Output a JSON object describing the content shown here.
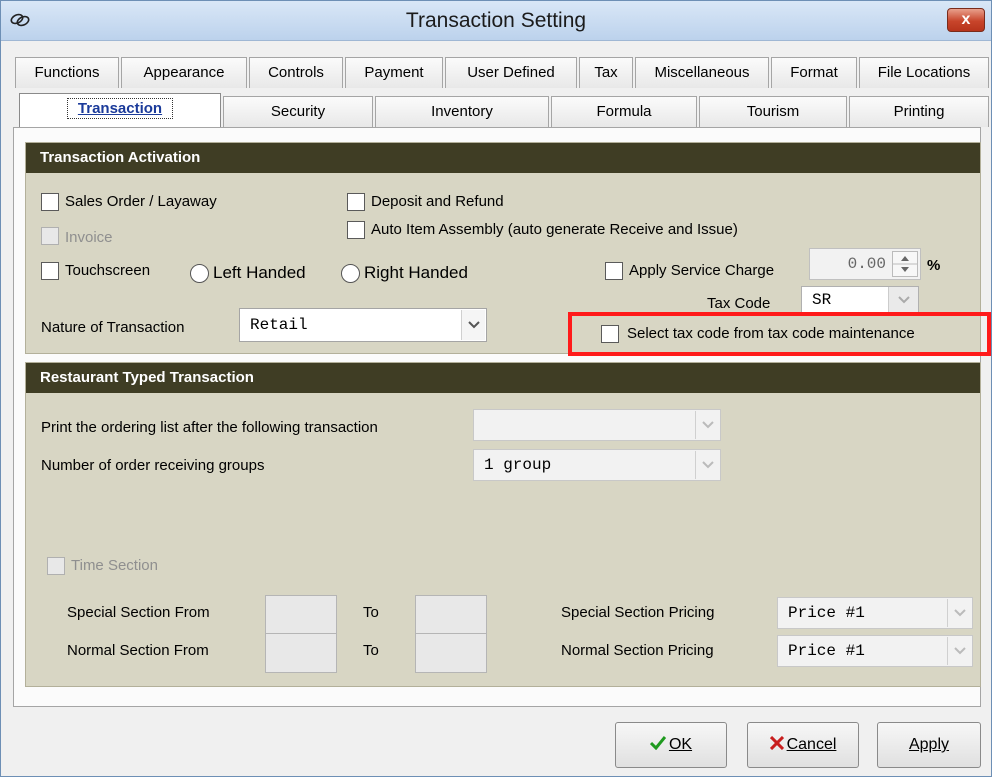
{
  "window": {
    "title": "Transaction Setting",
    "close_label": "x"
  },
  "tabs_row1": [
    "Functions",
    "Appearance",
    "Controls",
    "Payment",
    "User Defined",
    "Tax",
    "Miscellaneous",
    "Format",
    "File Locations"
  ],
  "tabs_row2": [
    "Transaction",
    "Security",
    "Inventory",
    "Formula",
    "Tourism",
    "Printing"
  ],
  "activation": {
    "header": "Transaction Activation",
    "sales_order": "Sales Order / Layaway",
    "invoice": "Invoice",
    "deposit_refund": "Deposit and Refund",
    "auto_assembly": "Auto Item Assembly (auto generate Receive and Issue)",
    "touchscreen": "Touchscreen",
    "left_handed": "Left Handed",
    "right_handed": "Right Handed",
    "apply_service_charge": "Apply Service Charge",
    "service_charge_value": "0.00",
    "percent": "%",
    "tax_code_label": "Tax Code",
    "tax_code_value": "SR",
    "nature_label": "Nature of Transaction",
    "nature_value": "Retail",
    "select_tax_code": "Select tax code from tax code maintenance"
  },
  "restaurant": {
    "header": "Restaurant Typed Transaction",
    "print_ordering_label": "Print the ordering list after the following transaction",
    "print_ordering_value": "",
    "order_groups_label": "Number of order receiving groups",
    "order_groups_value": "1 group",
    "time_section": "Time Section",
    "special_from": "Special Section From",
    "normal_from": "Normal Section From",
    "to": "To",
    "special_pricing": "Special Section Pricing",
    "normal_pricing": "Normal Section Pricing",
    "special_pricing_value": "Price #1",
    "normal_pricing_value": "Price #1"
  },
  "buttons": {
    "ok": "OK",
    "cancel": "Cancel",
    "apply": "Apply"
  },
  "colors": {
    "group_header": "#3f3d24",
    "group_body": "#d8d6c4",
    "highlight": "#ff1a1a",
    "active_tab_text": "#1a3a9a",
    "ok_check": "#1f9a1f",
    "cancel_x": "#c81e1e"
  }
}
